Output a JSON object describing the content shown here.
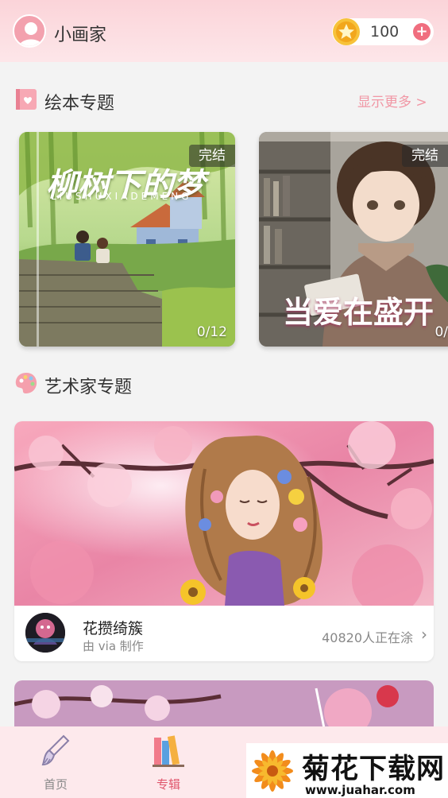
{
  "header": {
    "username": "小画家",
    "coins": "100",
    "coin_add_label": "+"
  },
  "picture_books": {
    "title": "绘本专题",
    "show_more": "显示更多 >",
    "items": [
      {
        "title": "柳树下的梦",
        "subtitle": "LIUSHUXIADEMENG",
        "status": "完结",
        "progress": "0/12"
      },
      {
        "title": "当爱在盛开",
        "status": "完结",
        "progress": "0/"
      }
    ]
  },
  "artists": {
    "title": "艺术家专题",
    "items": [
      {
        "name": "花攒绮簇",
        "by": "由 via 制作",
        "count": "40820人正在涂",
        "chevron": "›"
      }
    ]
  },
  "bottom_nav": {
    "items": [
      {
        "label": "首页",
        "icon": "brush-icon",
        "active": false
      },
      {
        "label": "专辑",
        "icon": "books-icon",
        "active": true
      }
    ]
  },
  "watermark": {
    "text": "菊花下载网",
    "url": "www.juahar.com"
  },
  "colors": {
    "accent": "#f06e7f",
    "header_bg": "#fbd4d9",
    "show_more": "#f197a5",
    "nav_active": "#e0566c",
    "nav_inactive": "#888888"
  }
}
